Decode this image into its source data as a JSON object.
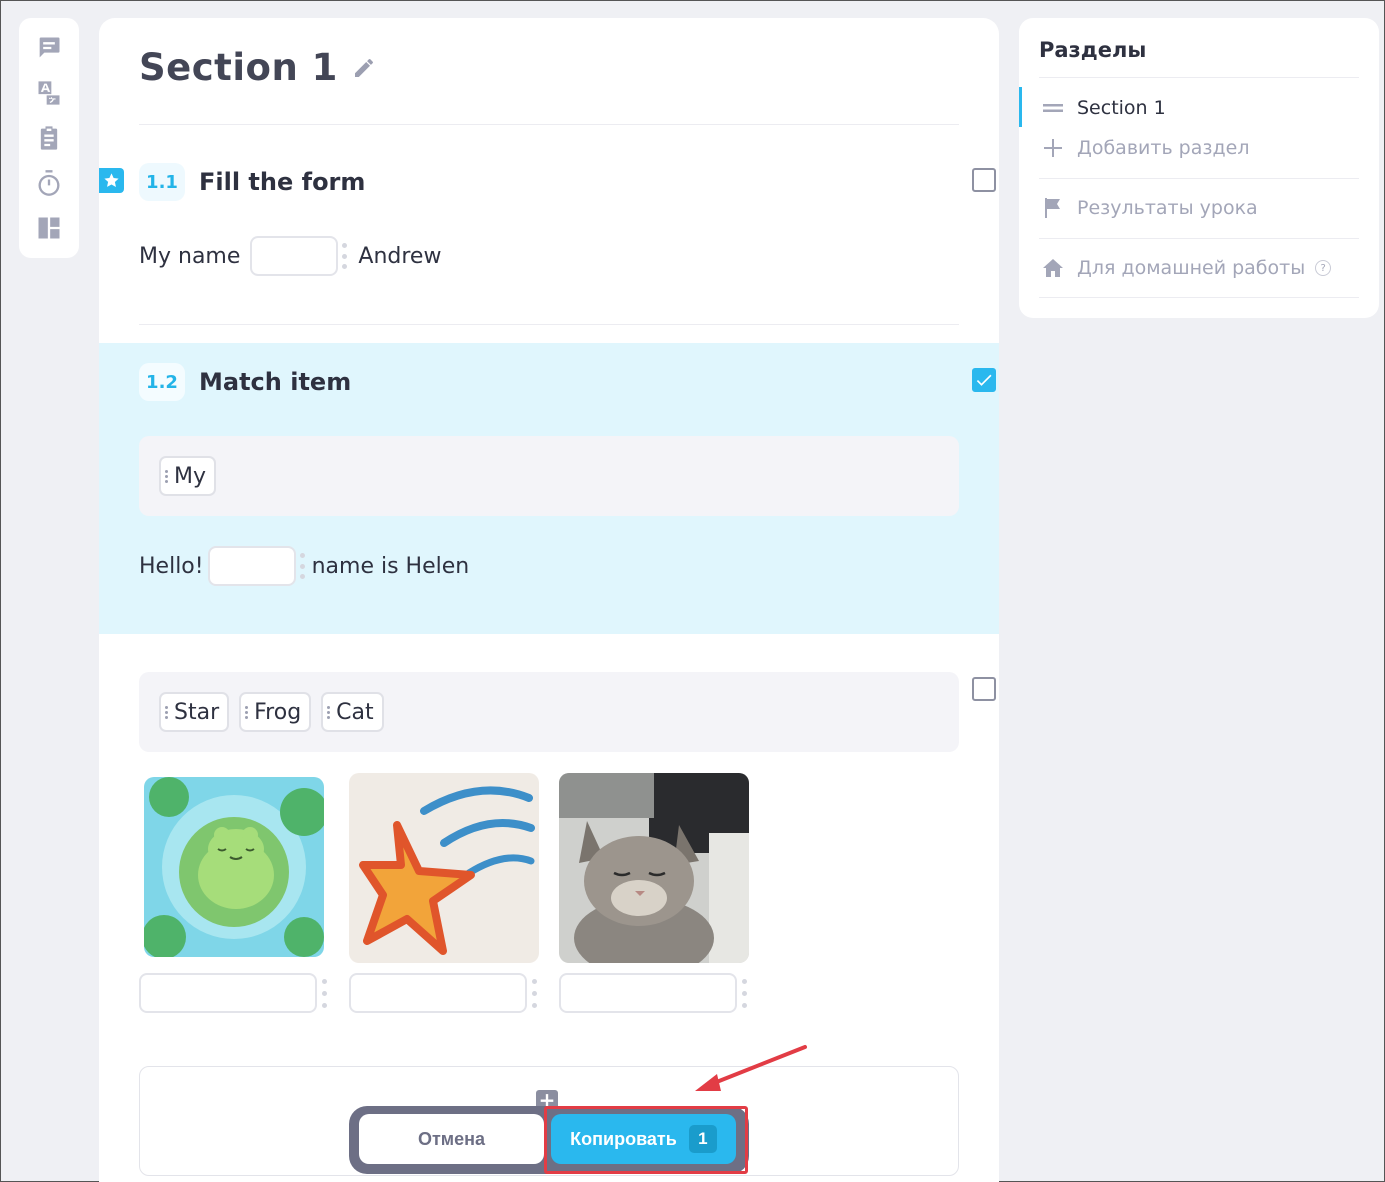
{
  "rail": {
    "icons": [
      "message-icon",
      "translate-icon",
      "clipboard-icon",
      "timer-icon",
      "layout-icon"
    ]
  },
  "page": {
    "title": "Section 1"
  },
  "exercises": [
    {
      "number": "1.1",
      "title": "Fill the form",
      "text_before": "My name",
      "text_after": "Andrew"
    },
    {
      "number": "1.2",
      "title": "Match item",
      "word_bank": [
        "My"
      ],
      "text_before": "Hello!",
      "text_after": "name is Helen"
    },
    {
      "word_bank": [
        "Star",
        "Frog",
        "Cat"
      ],
      "images": [
        "frog-image",
        "star-image",
        "cat-image"
      ]
    }
  ],
  "actions": {
    "cancel_label": "Отмена",
    "copy_label": "Копировать",
    "copy_count": "1"
  },
  "sidebar": {
    "title": "Разделы",
    "items": [
      {
        "label": "Section 1"
      },
      {
        "label": "Добавить раздел"
      },
      {
        "label": "Результаты урока"
      },
      {
        "label": "Для домашней работы"
      }
    ],
    "help": "?"
  },
  "colors": {
    "accent": "#2ab8ee",
    "highlight_bg": "#e0f6fd",
    "annotation": "#e23c45"
  }
}
